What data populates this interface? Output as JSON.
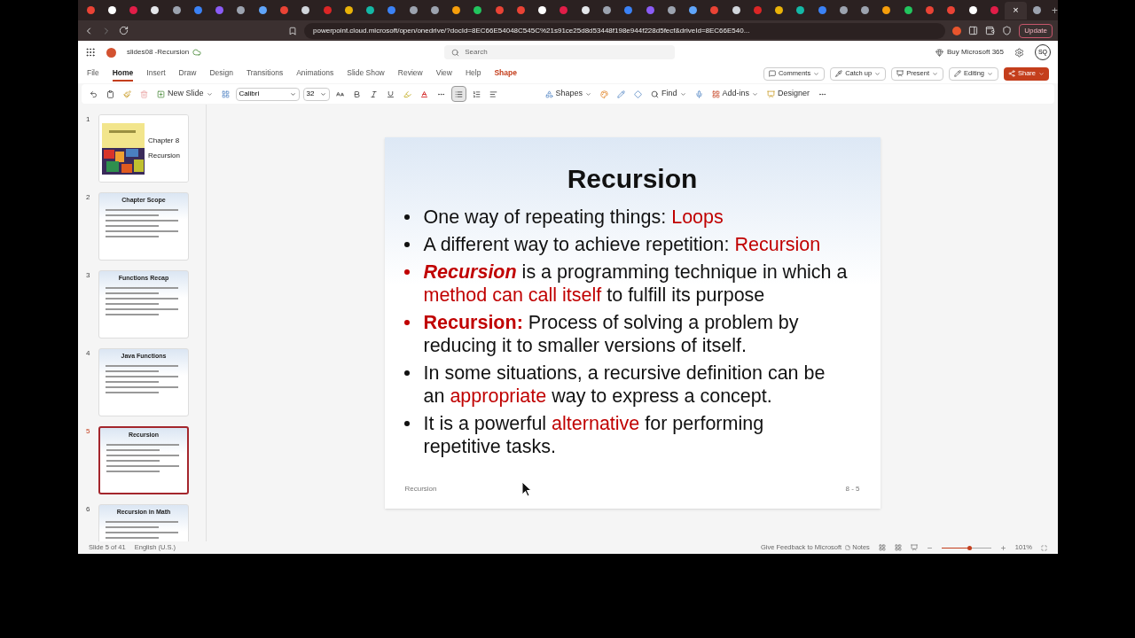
{
  "browser": {
    "tabs": [
      {
        "selected": false
      },
      {
        "selected": false
      },
      {
        "selected": false
      },
      {
        "selected": false
      },
      {
        "selected": false
      },
      {
        "selected": false
      },
      {
        "selected": false
      },
      {
        "selected": false
      },
      {
        "selected": false
      },
      {
        "selected": false
      },
      {
        "selected": false
      },
      {
        "selected": false
      },
      {
        "selected": false
      },
      {
        "selected": false
      },
      {
        "selected": false
      },
      {
        "selected": false
      },
      {
        "selected": false
      },
      {
        "selected": false
      },
      {
        "selected": false
      },
      {
        "selected": false
      },
      {
        "selected": false
      },
      {
        "selected": false
      },
      {
        "selected": false
      },
      {
        "selected": false
      },
      {
        "selected": false
      },
      {
        "selected": false
      },
      {
        "selected": false
      },
      {
        "selected": false
      },
      {
        "selected": false
      },
      {
        "selected": false
      },
      {
        "selected": false
      },
      {
        "selected": false
      },
      {
        "selected": false
      },
      {
        "selected": false
      },
      {
        "selected": false
      },
      {
        "selected": false
      },
      {
        "selected": false
      },
      {
        "selected": false
      },
      {
        "selected": false
      },
      {
        "selected": false
      },
      {
        "selected": false
      },
      {
        "selected": false
      },
      {
        "selected": false
      },
      {
        "selected": true
      },
      {
        "selected": false
      }
    ],
    "new_tab": "+",
    "close_tab": "×",
    "url": "powerpoint.cloud.microsoft/open/onedrive/?docId=8EC66E54048C545C%21s91ce25d8d53448f198e944f228d5fecf&driveId=8EC66E540...",
    "update_label": "Update"
  },
  "app": {
    "file_name": "slides08 -Recursion",
    "search_placeholder": "Search",
    "buy_label": "Buy Microsoft 365",
    "avatar_initials": "SQ"
  },
  "menu": [
    {
      "label": "File",
      "selected": false,
      "kind": "tab"
    },
    {
      "label": "Home",
      "selected": true,
      "kind": "tab"
    },
    {
      "label": "Insert",
      "selected": false,
      "kind": "tab"
    },
    {
      "label": "Draw",
      "selected": false,
      "kind": "tab"
    },
    {
      "label": "Design",
      "selected": false,
      "kind": "tab"
    },
    {
      "label": "Transitions",
      "selected": false,
      "kind": "tab"
    },
    {
      "label": "Animations",
      "selected": false,
      "kind": "tab"
    },
    {
      "label": "Slide Show",
      "selected": false,
      "kind": "tab"
    },
    {
      "label": "Review",
      "selected": false,
      "kind": "tab"
    },
    {
      "label": "View",
      "selected": false,
      "kind": "tab"
    },
    {
      "label": "Help",
      "selected": false,
      "kind": "tab"
    },
    {
      "label": "Shape",
      "selected": false,
      "kind": "contextual"
    }
  ],
  "actions": [
    {
      "label": "Comments",
      "kind": "comments"
    },
    {
      "label": "Catch up",
      "kind": "catchup"
    },
    {
      "label": "Present",
      "kind": "present"
    },
    {
      "label": "Editing",
      "kind": "editing"
    },
    {
      "label": "Share",
      "kind": "share"
    }
  ],
  "toolbar": {
    "new_slide": "New Slide",
    "font": "Calibri",
    "size": "32",
    "shapes": "Shapes",
    "find": "Find",
    "addins": "Add-ins",
    "designer": "Designer"
  },
  "thumbnails": [
    {
      "number": "1",
      "selected": false,
      "kind": "cover",
      "title_lines": [
        "Chapter 8",
        "Recursion"
      ]
    },
    {
      "number": "2",
      "selected": false,
      "kind": "bullets",
      "title": "Chapter Scope"
    },
    {
      "number": "3",
      "selected": false,
      "kind": "bullets",
      "title": "Functions Recap"
    },
    {
      "number": "4",
      "selected": false,
      "kind": "bullets",
      "title": "Java Functions"
    },
    {
      "number": "5",
      "selected": true,
      "kind": "bullets",
      "title": "Recursion"
    },
    {
      "number": "6",
      "selected": false,
      "kind": "bullets",
      "title": "Recursion in Math"
    }
  ],
  "slide": {
    "title": "Recursion",
    "bullets": [
      {
        "red": false,
        "lines": [
          [
            {
              "text": "One way of repeating things: ",
              "red": false,
              "italic": false,
              "bold": false
            },
            {
              "text": "Loops",
              "red": true,
              "italic": false,
              "bold": false
            }
          ]
        ]
      },
      {
        "red": false,
        "lines": [
          [
            {
              "text": "A different way to achieve repetition: ",
              "red": false,
              "italic": false,
              "bold": false
            },
            {
              "text": "Recursion",
              "red": true,
              "italic": false,
              "bold": false
            }
          ]
        ]
      },
      {
        "red": true,
        "lines": [
          [
            {
              "text": "Recursion",
              "red": true,
              "italic": true,
              "bold": true
            },
            {
              "text": " is a programming technique in which a",
              "red": false,
              "italic": false,
              "bold": false
            }
          ],
          [
            {
              "text": "method can call itself",
              "red": true,
              "italic": false,
              "bold": false
            },
            {
              "text": " to fulfill its purpose",
              "red": false,
              "italic": false,
              "bold": false
            }
          ]
        ]
      },
      {
        "red": true,
        "lines": [
          [
            {
              "text": "Recursion:",
              "red": true,
              "italic": false,
              "bold": true
            },
            {
              "text": " Process of solving a problem by",
              "red": false,
              "italic": false,
              "bold": false
            }
          ],
          [
            {
              "text": "reducing it to smaller versions of itself.",
              "red": false,
              "italic": false,
              "bold": false
            }
          ]
        ]
      },
      {
        "red": false,
        "lines": [
          [
            {
              "text": "In some situations, a recursive definition can be",
              "red": false,
              "italic": false,
              "bold": false
            }
          ],
          [
            {
              "text": "an ",
              "red": false,
              "italic": false,
              "bold": false
            },
            {
              "text": "appropriate",
              "red": true,
              "italic": false,
              "bold": false
            },
            {
              "text": " way to express a concept.",
              "red": false,
              "italic": false,
              "bold": false
            }
          ]
        ]
      },
      {
        "red": false,
        "lines": [
          [
            {
              "text": "It is a powerful ",
              "red": false,
              "italic": false,
              "bold": false
            },
            {
              "text": "alternative",
              "red": true,
              "italic": false,
              "bold": false
            },
            {
              "text": " for performing",
              "red": false,
              "italic": false,
              "bold": false
            }
          ],
          [
            {
              "text": "repetitive tasks.",
              "red": false,
              "italic": false,
              "bold": false
            }
          ]
        ]
      }
    ],
    "footer_left": "Recursion",
    "footer_right": "8 - 5"
  },
  "status": {
    "slide_position": "Slide 5 of 41",
    "language": "English (U.S.)",
    "feedback": "Give Feedback to Microsoft",
    "notes": "Notes",
    "zoom_slider": {
      "level": 0.55
    },
    "zoom": "101%"
  }
}
